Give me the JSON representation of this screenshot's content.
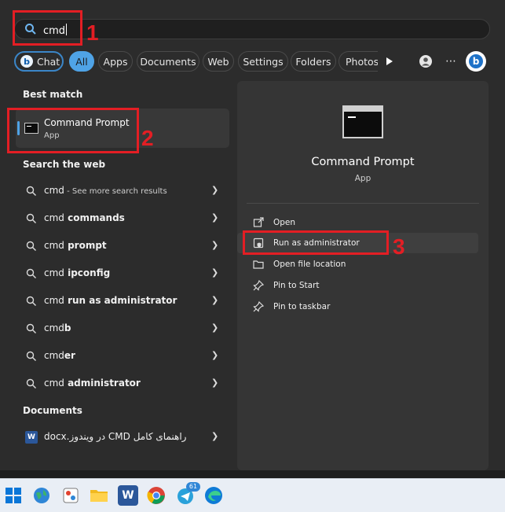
{
  "search": {
    "query": "cmd"
  },
  "tabs": [
    {
      "label": "Chat"
    },
    {
      "label": "All"
    },
    {
      "label": "Apps"
    },
    {
      "label": "Documents"
    },
    {
      "label": "Web"
    },
    {
      "label": "Settings"
    },
    {
      "label": "Folders"
    },
    {
      "label": "Photos"
    }
  ],
  "best_match": {
    "heading": "Best match",
    "title": "Command Prompt",
    "subtitle": "App"
  },
  "web": {
    "heading": "Search the web",
    "items": [
      {
        "term": "cmd",
        "rest": "",
        "sub": " - See more search results"
      },
      {
        "term": "cmd",
        "rest": " commands",
        "sub": ""
      },
      {
        "term": "cmd",
        "rest": " prompt",
        "sub": ""
      },
      {
        "term": "cmd",
        "rest": " ipconfig",
        "sub": ""
      },
      {
        "term": "cmd",
        "rest": " run as administrator",
        "sub": ""
      },
      {
        "term": "cmd",
        "rest": "b",
        "sub": ""
      },
      {
        "term": "cmd",
        "rest": "er",
        "sub": ""
      },
      {
        "term": "cmd",
        "rest": " administrator",
        "sub": ""
      }
    ]
  },
  "documents": {
    "heading": "Documents",
    "items": [
      {
        "label": "راهنمای کامل CMD در ویندوز.docx"
      }
    ]
  },
  "detail": {
    "title": "Command Prompt",
    "subtitle": "App",
    "actions": [
      {
        "label": "Open"
      },
      {
        "label": "Run as administrator"
      },
      {
        "label": "Open file location"
      },
      {
        "label": "Pin to Start"
      },
      {
        "label": "Pin to taskbar"
      }
    ]
  },
  "annotations": {
    "n1": "1",
    "n2": "2",
    "n3": "3"
  },
  "taskbar": {
    "telegram_badge": "61"
  },
  "colors": {
    "accent": "#4fa3e6",
    "annotation": "#e31e24",
    "panel": "#2c2c2c"
  }
}
